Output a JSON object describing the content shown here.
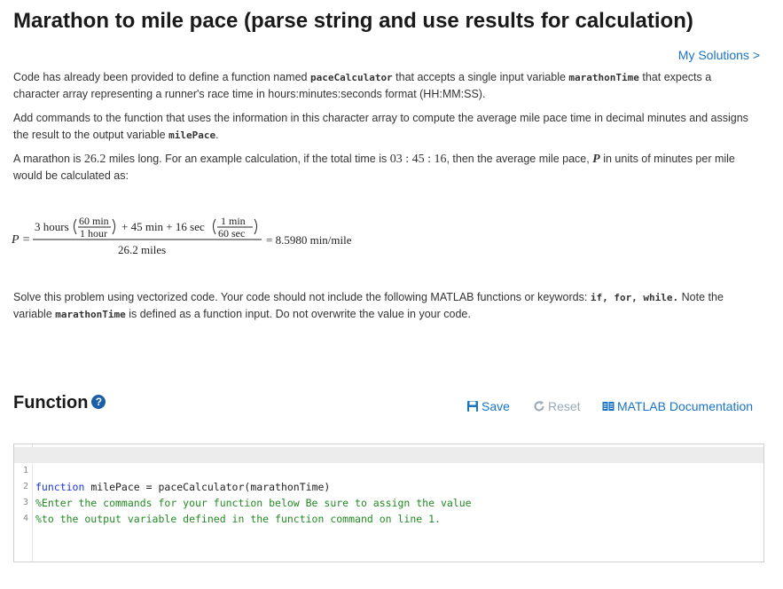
{
  "title": "Marathon to mile pace (parse string and use results for calculation)",
  "my_solutions": "My Solutions >",
  "p1": {
    "a": "Code has already been provided to define a function named ",
    "b": "paceCalculator",
    "c": " that accepts a single input variable ",
    "d": "marathonTime",
    "e": " that expects a character array representing a runner's race time in hours:minutes:seconds format (HH:MM:SS)."
  },
  "p2": {
    "a": "Add commands to the function that uses the information in this character array to compute the average mile pace time in decimal minutes and assigns the result to the output variable ",
    "b": "milePace",
    "c": "."
  },
  "p3": {
    "a": "A marathon is ",
    "b": "26.2",
    "c": " miles long. For an example calculation, if the total time is ",
    "d": "03 : 45 : 16",
    "e": ", then the average mile pace, ",
    "f": "P",
    "g": " in units of minutes per mile would be calculated as:"
  },
  "formula": {
    "lhs": "P =",
    "t1": "3 hours",
    "f1_num": "60 min",
    "f1_den": "1 hour",
    "t2": "+ 45 min + 16 sec",
    "f2_num": "1 min",
    "f2_den": "60 sec",
    "den": "26.2 miles",
    "result": "= 8.5980 min/mile"
  },
  "p4": {
    "a": "Solve this problem using vectorized code.  Your code should not include the following MATLAB functions or keywords: ",
    "b": "if, for, while.",
    "c": "  Note the variable ",
    "d": "marathonTime",
    "e": " is defined as a function input.  Do not overwrite the value in your code."
  },
  "function_heading": "Function",
  "help_icon_glyph": "?",
  "toolbar": {
    "save": "Save",
    "reset": "Reset",
    "docs": "MATLAB Documentation"
  },
  "editor": {
    "lines": [
      {
        "num": "1",
        "kw": "function",
        "rest": " milePace = paceCalculator(marathonTime)"
      },
      {
        "num": "2",
        "comment": "%Enter the commands for your function below Be sure to assign the value"
      },
      {
        "num": "3",
        "comment": "%to the output variable defined in the function command on line 1."
      },
      {
        "num": "4",
        "rest": ""
      }
    ]
  },
  "colors": {
    "link": "#1a73c5",
    "keyword": "#1a36d8",
    "comment": "#228b22",
    "help_icon": "#1a5fa8"
  },
  "icons": {
    "save": "floppy-disk-icon",
    "reset": "refresh-icon",
    "docs": "book-icon",
    "help": "question-circle-icon"
  }
}
